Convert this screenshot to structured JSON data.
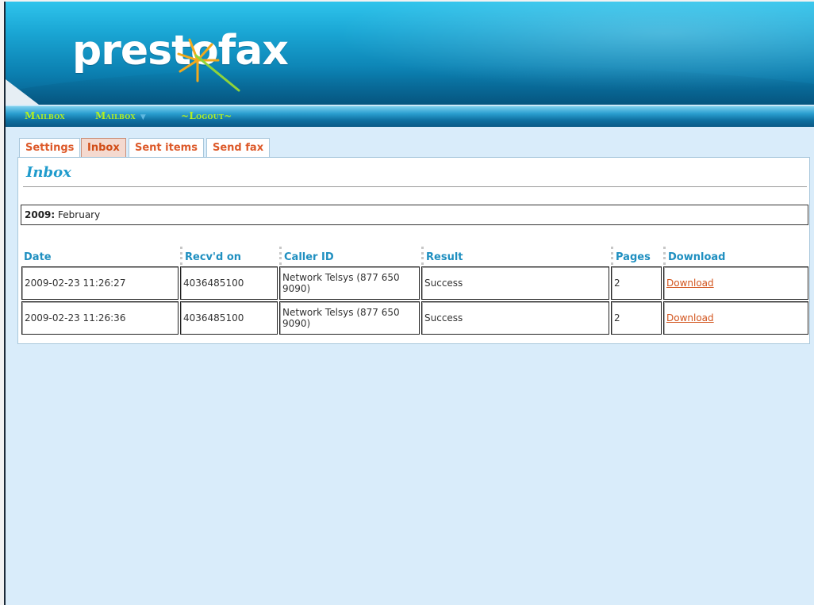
{
  "brand": {
    "logo_text": "prestofax"
  },
  "nav": {
    "items": [
      {
        "label": "Mailbox"
      },
      {
        "label": "Mailbox"
      },
      {
        "label": "~Logout~"
      }
    ]
  },
  "tabs": [
    {
      "label": "Settings",
      "active": false
    },
    {
      "label": "Inbox",
      "active": true
    },
    {
      "label": "Sent items",
      "active": false
    },
    {
      "label": "Send fax",
      "active": false
    }
  ],
  "panel": {
    "title": "Inbox",
    "year_label": "2009:",
    "month_label": "February"
  },
  "table": {
    "headers": [
      "Date",
      "Recv'd on",
      "Caller ID",
      "Result",
      "Pages",
      "Download"
    ],
    "rows": [
      {
        "date": "2009-02-23 11:26:27",
        "recvd_on": "4036485100",
        "caller_id": "Network Telsys (877 650 9090)",
        "result": "Success",
        "pages": "2",
        "download": "Download"
      },
      {
        "date": "2009-02-23 11:26:36",
        "recvd_on": "4036485100",
        "caller_id": "Network Telsys (877 650 9090)",
        "result": "Success",
        "pages": "2",
        "download": "Download"
      }
    ]
  },
  "colors": {
    "accent_orange": "#dd5a2a",
    "heading_blue": "#1f9bcc",
    "nav_text_green": "#b4f020",
    "page_background": "#d9ecfa"
  }
}
